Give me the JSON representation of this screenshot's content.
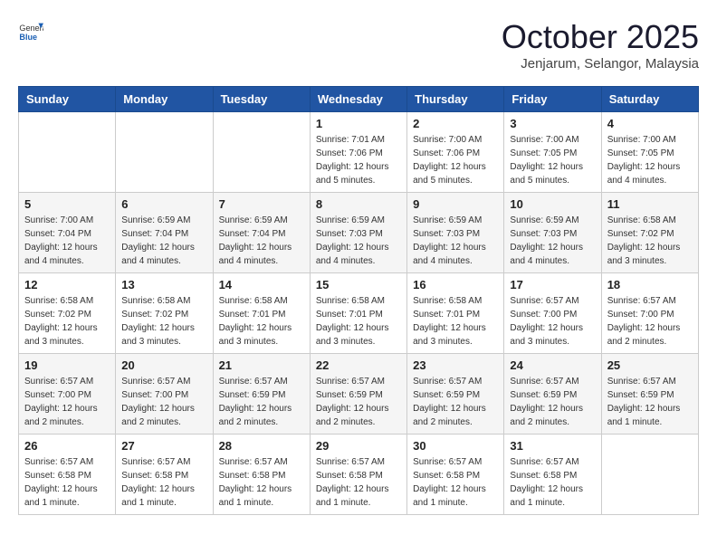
{
  "logo": {
    "general": "General",
    "blue": "Blue"
  },
  "header": {
    "month": "October 2025",
    "location": "Jenjarum, Selangor, Malaysia"
  },
  "weekdays": [
    "Sunday",
    "Monday",
    "Tuesday",
    "Wednesday",
    "Thursday",
    "Friday",
    "Saturday"
  ],
  "weeks": [
    [
      {
        "day": "",
        "sunrise": "",
        "sunset": "",
        "daylight": ""
      },
      {
        "day": "",
        "sunrise": "",
        "sunset": "",
        "daylight": ""
      },
      {
        "day": "",
        "sunrise": "",
        "sunset": "",
        "daylight": ""
      },
      {
        "day": "1",
        "sunrise": "Sunrise: 7:01 AM",
        "sunset": "Sunset: 7:06 PM",
        "daylight": "Daylight: 12 hours and 5 minutes."
      },
      {
        "day": "2",
        "sunrise": "Sunrise: 7:00 AM",
        "sunset": "Sunset: 7:06 PM",
        "daylight": "Daylight: 12 hours and 5 minutes."
      },
      {
        "day": "3",
        "sunrise": "Sunrise: 7:00 AM",
        "sunset": "Sunset: 7:05 PM",
        "daylight": "Daylight: 12 hours and 5 minutes."
      },
      {
        "day": "4",
        "sunrise": "Sunrise: 7:00 AM",
        "sunset": "Sunset: 7:05 PM",
        "daylight": "Daylight: 12 hours and 4 minutes."
      }
    ],
    [
      {
        "day": "5",
        "sunrise": "Sunrise: 7:00 AM",
        "sunset": "Sunset: 7:04 PM",
        "daylight": "Daylight: 12 hours and 4 minutes."
      },
      {
        "day": "6",
        "sunrise": "Sunrise: 6:59 AM",
        "sunset": "Sunset: 7:04 PM",
        "daylight": "Daylight: 12 hours and 4 minutes."
      },
      {
        "day": "7",
        "sunrise": "Sunrise: 6:59 AM",
        "sunset": "Sunset: 7:04 PM",
        "daylight": "Daylight: 12 hours and 4 minutes."
      },
      {
        "day": "8",
        "sunrise": "Sunrise: 6:59 AM",
        "sunset": "Sunset: 7:03 PM",
        "daylight": "Daylight: 12 hours and 4 minutes."
      },
      {
        "day": "9",
        "sunrise": "Sunrise: 6:59 AM",
        "sunset": "Sunset: 7:03 PM",
        "daylight": "Daylight: 12 hours and 4 minutes."
      },
      {
        "day": "10",
        "sunrise": "Sunrise: 6:59 AM",
        "sunset": "Sunset: 7:03 PM",
        "daylight": "Daylight: 12 hours and 4 minutes."
      },
      {
        "day": "11",
        "sunrise": "Sunrise: 6:58 AM",
        "sunset": "Sunset: 7:02 PM",
        "daylight": "Daylight: 12 hours and 3 minutes."
      }
    ],
    [
      {
        "day": "12",
        "sunrise": "Sunrise: 6:58 AM",
        "sunset": "Sunset: 7:02 PM",
        "daylight": "Daylight: 12 hours and 3 minutes."
      },
      {
        "day": "13",
        "sunrise": "Sunrise: 6:58 AM",
        "sunset": "Sunset: 7:02 PM",
        "daylight": "Daylight: 12 hours and 3 minutes."
      },
      {
        "day": "14",
        "sunrise": "Sunrise: 6:58 AM",
        "sunset": "Sunset: 7:01 PM",
        "daylight": "Daylight: 12 hours and 3 minutes."
      },
      {
        "day": "15",
        "sunrise": "Sunrise: 6:58 AM",
        "sunset": "Sunset: 7:01 PM",
        "daylight": "Daylight: 12 hours and 3 minutes."
      },
      {
        "day": "16",
        "sunrise": "Sunrise: 6:58 AM",
        "sunset": "Sunset: 7:01 PM",
        "daylight": "Daylight: 12 hours and 3 minutes."
      },
      {
        "day": "17",
        "sunrise": "Sunrise: 6:57 AM",
        "sunset": "Sunset: 7:00 PM",
        "daylight": "Daylight: 12 hours and 3 minutes."
      },
      {
        "day": "18",
        "sunrise": "Sunrise: 6:57 AM",
        "sunset": "Sunset: 7:00 PM",
        "daylight": "Daylight: 12 hours and 2 minutes."
      }
    ],
    [
      {
        "day": "19",
        "sunrise": "Sunrise: 6:57 AM",
        "sunset": "Sunset: 7:00 PM",
        "daylight": "Daylight: 12 hours and 2 minutes."
      },
      {
        "day": "20",
        "sunrise": "Sunrise: 6:57 AM",
        "sunset": "Sunset: 7:00 PM",
        "daylight": "Daylight: 12 hours and 2 minutes."
      },
      {
        "day": "21",
        "sunrise": "Sunrise: 6:57 AM",
        "sunset": "Sunset: 6:59 PM",
        "daylight": "Daylight: 12 hours and 2 minutes."
      },
      {
        "day": "22",
        "sunrise": "Sunrise: 6:57 AM",
        "sunset": "Sunset: 6:59 PM",
        "daylight": "Daylight: 12 hours and 2 minutes."
      },
      {
        "day": "23",
        "sunrise": "Sunrise: 6:57 AM",
        "sunset": "Sunset: 6:59 PM",
        "daylight": "Daylight: 12 hours and 2 minutes."
      },
      {
        "day": "24",
        "sunrise": "Sunrise: 6:57 AM",
        "sunset": "Sunset: 6:59 PM",
        "daylight": "Daylight: 12 hours and 2 minutes."
      },
      {
        "day": "25",
        "sunrise": "Sunrise: 6:57 AM",
        "sunset": "Sunset: 6:59 PM",
        "daylight": "Daylight: 12 hours and 1 minute."
      }
    ],
    [
      {
        "day": "26",
        "sunrise": "Sunrise: 6:57 AM",
        "sunset": "Sunset: 6:58 PM",
        "daylight": "Daylight: 12 hours and 1 minute."
      },
      {
        "day": "27",
        "sunrise": "Sunrise: 6:57 AM",
        "sunset": "Sunset: 6:58 PM",
        "daylight": "Daylight: 12 hours and 1 minute."
      },
      {
        "day": "28",
        "sunrise": "Sunrise: 6:57 AM",
        "sunset": "Sunset: 6:58 PM",
        "daylight": "Daylight: 12 hours and 1 minute."
      },
      {
        "day": "29",
        "sunrise": "Sunrise: 6:57 AM",
        "sunset": "Sunset: 6:58 PM",
        "daylight": "Daylight: 12 hours and 1 minute."
      },
      {
        "day": "30",
        "sunrise": "Sunrise: 6:57 AM",
        "sunset": "Sunset: 6:58 PM",
        "daylight": "Daylight: 12 hours and 1 minute."
      },
      {
        "day": "31",
        "sunrise": "Sunrise: 6:57 AM",
        "sunset": "Sunset: 6:58 PM",
        "daylight": "Daylight: 12 hours and 1 minute."
      },
      {
        "day": "",
        "sunrise": "",
        "sunset": "",
        "daylight": ""
      }
    ]
  ]
}
